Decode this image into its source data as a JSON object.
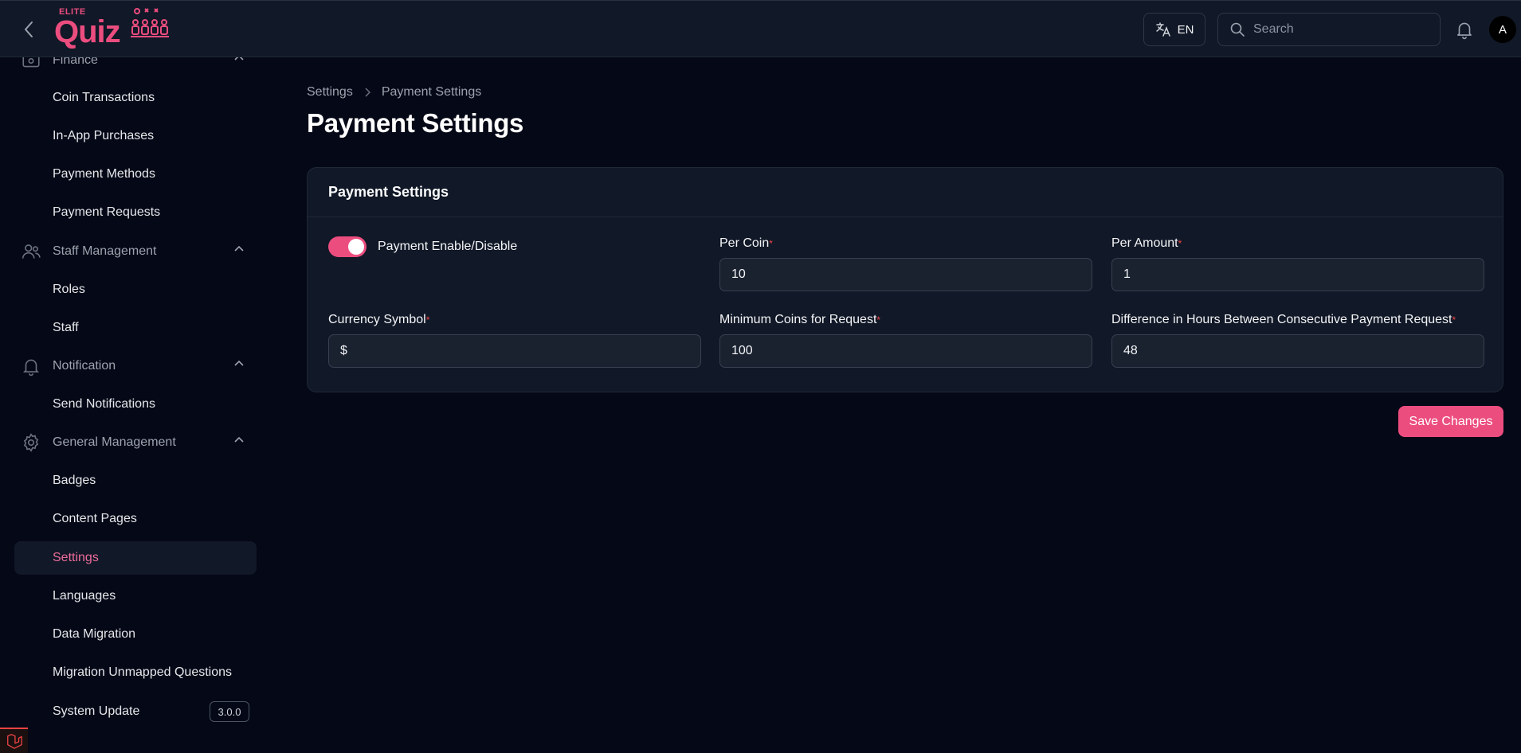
{
  "topbar": {
    "logo_small": "ELITE",
    "logo_main": "Quiz",
    "language": "EN",
    "search_placeholder": "Search",
    "avatar_initial": "A"
  },
  "sidebar": {
    "groups": [
      {
        "label": "Finance",
        "icon": "wallet-icon"
      },
      {
        "label": "Staff Management",
        "icon": "users-icon"
      },
      {
        "label": "Notification",
        "icon": "bell-icon"
      },
      {
        "label": "General Management",
        "icon": "gear-icon"
      }
    ],
    "items": [
      {
        "label": "Coin Transactions"
      },
      {
        "label": "In-App Purchases"
      },
      {
        "label": "Payment Methods"
      },
      {
        "label": "Payment Requests"
      },
      {
        "label": "Roles"
      },
      {
        "label": "Staff"
      },
      {
        "label": "Send Notifications"
      },
      {
        "label": "Badges"
      },
      {
        "label": "Content Pages"
      },
      {
        "label": "Settings"
      },
      {
        "label": "Languages"
      },
      {
        "label": "Data Migration"
      },
      {
        "label": "Migration Unmapped Questions"
      },
      {
        "label": "System Update"
      }
    ],
    "active_item": "Settings",
    "version": "3.0.0"
  },
  "breadcrumb": {
    "parent": "Settings",
    "current": "Payment Settings"
  },
  "page_title": "Payment Settings",
  "card": {
    "title": "Payment Settings",
    "toggle": {
      "label": "Payment Enable/Disable",
      "on": true
    },
    "fields": {
      "per_coin": {
        "label": "Per Coin",
        "value": "10"
      },
      "per_amount": {
        "label": "Per Amount",
        "value": "1"
      },
      "currency_symbol": {
        "label": "Currency Symbol",
        "value": "$"
      },
      "min_coins": {
        "label": "Minimum Coins for Request",
        "value": "100"
      },
      "difference_hours": {
        "label": "Difference in Hours Between Consecutive Payment Request",
        "value": "48"
      }
    },
    "required_mark": "*"
  },
  "save_label": "Save Changes",
  "colors": {
    "accent": "#ec4d7f",
    "background": "#050816",
    "card": "#111827"
  }
}
